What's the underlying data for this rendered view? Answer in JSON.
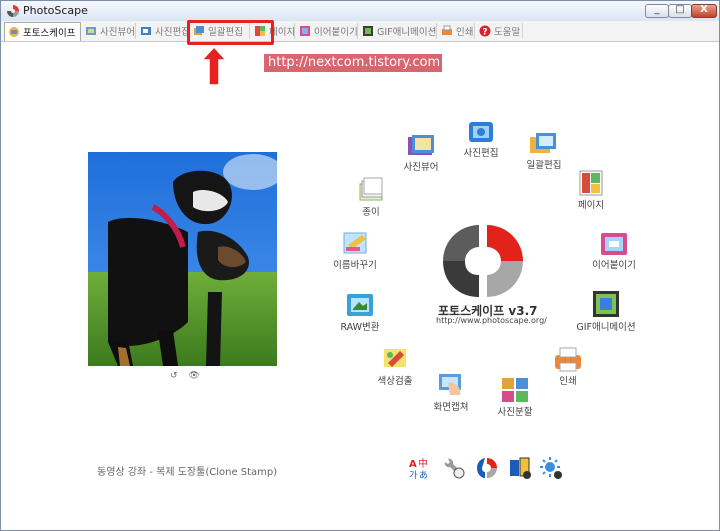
{
  "window": {
    "title": "PhotoScape",
    "minimize": "_",
    "maximize": "□",
    "close": "X"
  },
  "tabs": [
    {
      "label": "포토스케이프",
      "icon": "photoscape-icon",
      "active": true
    },
    {
      "label": "사진뷰어",
      "icon": "viewer-icon"
    },
    {
      "label": "사진편집",
      "icon": "editor-icon"
    },
    {
      "label": "일괄편집",
      "icon": "batch-editor-icon"
    },
    {
      "label": "페이지",
      "icon": "page-icon"
    },
    {
      "label": "이어붙이기",
      "icon": "combine-icon"
    },
    {
      "label": "GIF애니메이션",
      "icon": "gif-icon"
    },
    {
      "label": "인쇄",
      "icon": "print-icon"
    },
    {
      "label": "도움말",
      "icon": "help-icon"
    }
  ],
  "annotation": {
    "url": "http://nextcom.tistory.com"
  },
  "center": {
    "title": "포토스케이프 v3.7",
    "url": "http://www.photoscape.org/"
  },
  "menu": {
    "viewer": "사진뷰어",
    "editor": "사진편집",
    "batch": "일괄편집",
    "page": "페이지",
    "combine": "이어붙이기",
    "gif": "GIF애니메이션",
    "print": "인쇄",
    "splitter": "사진분할",
    "screen": "화면캡쳐",
    "color": "색상검출",
    "raw": "RAW변환",
    "rename": "이름바꾸기",
    "paper": "종이"
  },
  "photo_tools": {
    "rotate": "↺",
    "view": "👁"
  },
  "tip": "동영상 강좌 - 복제 도장툴(Clone Stamp)",
  "bottom_icons": [
    "language-icon",
    "tools-icon",
    "photoscape-app-icon",
    "news-icon",
    "sun-icon"
  ]
}
